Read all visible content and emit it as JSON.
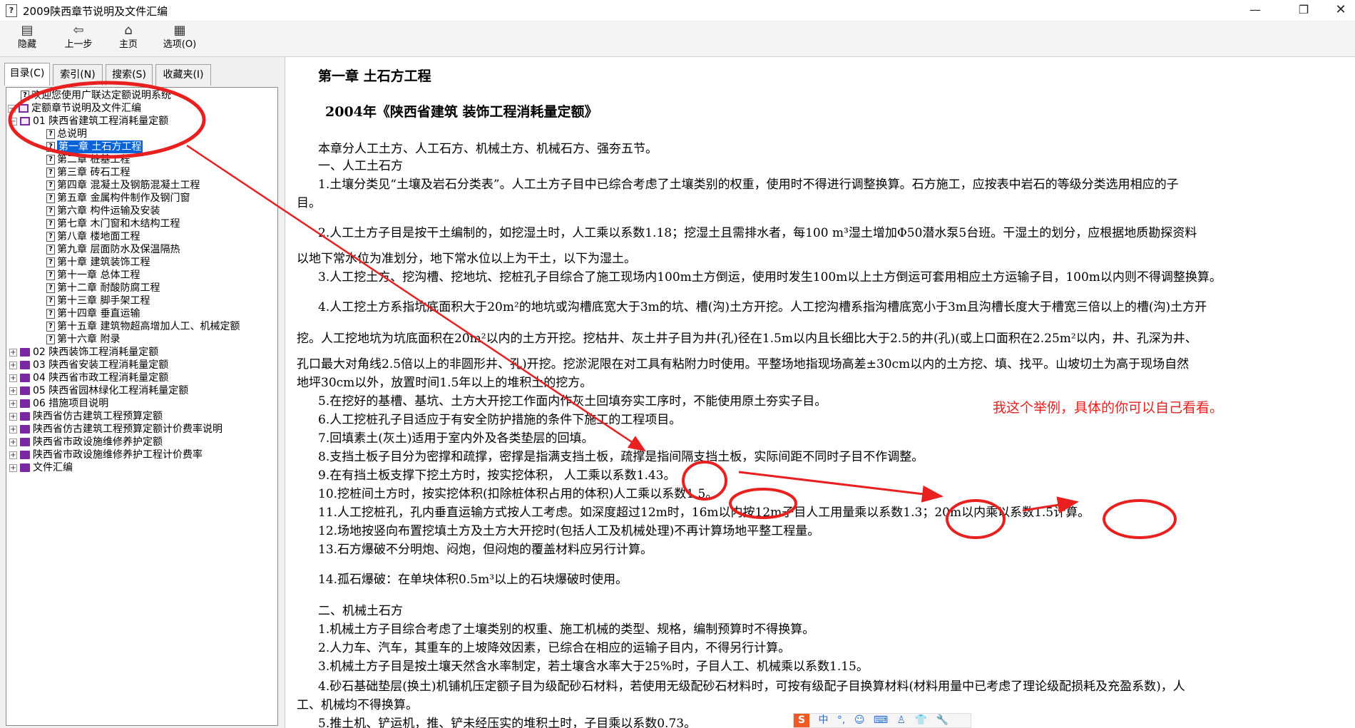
{
  "window": {
    "title": "2009陕西章节说明及文件汇编",
    "icon_glyph": "?",
    "minimize_glyph": "—",
    "maximize_glyph": "❐",
    "close_glyph": "✕"
  },
  "toolbar": {
    "hide": {
      "label": "隐藏",
      "icon": "hide-pane-icon",
      "glyph": "▤"
    },
    "back": {
      "label": "上一步",
      "icon": "back-arrow-icon",
      "glyph": "⇦"
    },
    "home": {
      "label": "主页",
      "icon": "home-icon",
      "glyph": "⌂"
    },
    "options": {
      "label": "选项(O)",
      "icon": "options-icon",
      "glyph": "▦"
    }
  },
  "tabs": [
    "目录(C)",
    "索引(N)",
    "搜索(S)",
    "收藏夹(I)"
  ],
  "tree": [
    {
      "text": "欢迎您使用广联达定额说明系统",
      "level": 1,
      "type": "doc"
    },
    {
      "text": "定额章节说明及文件汇编",
      "level": 0,
      "type": "bookopen",
      "exp": "⊟"
    },
    {
      "text": "01 陕西省建筑工程消耗量定额",
      "level": 1,
      "type": "bookopen",
      "exp": "⊟"
    },
    {
      "text": "总说明",
      "level": 2,
      "type": "doc"
    },
    {
      "text": "第一章 土石方工程",
      "level": 2,
      "type": "doc",
      "selected": true
    },
    {
      "text": "第二章 桩基工程",
      "level": 2,
      "type": "doc"
    },
    {
      "text": "第三章 砖石工程",
      "level": 2,
      "type": "doc"
    },
    {
      "text": "第四章 混凝土及钢筋混凝土工程",
      "level": 2,
      "type": "doc"
    },
    {
      "text": "第五章 金属构件制作及钢门窗",
      "level": 2,
      "type": "doc"
    },
    {
      "text": "第六章 构件运输及安装",
      "level": 2,
      "type": "doc"
    },
    {
      "text": "第七章 木门窗和木结构工程",
      "level": 2,
      "type": "doc"
    },
    {
      "text": "第八章 楼地面工程",
      "level": 2,
      "type": "doc"
    },
    {
      "text": "第九章 层面防水及保温隔热",
      "level": 2,
      "type": "doc"
    },
    {
      "text": "第十章 建筑装饰工程",
      "level": 2,
      "type": "doc"
    },
    {
      "text": "第十一章 总体工程",
      "level": 2,
      "type": "doc"
    },
    {
      "text": "第十二章 耐酸防腐工程",
      "level": 2,
      "type": "doc"
    },
    {
      "text": "第十三章 脚手架工程",
      "level": 2,
      "type": "doc"
    },
    {
      "text": "第十四章 垂直运输",
      "level": 2,
      "type": "doc"
    },
    {
      "text": "第十五章 建筑物超高增加人工、机械定额",
      "level": 2,
      "type": "doc"
    },
    {
      "text": "第十六章 附录",
      "level": 2,
      "type": "doc"
    },
    {
      "text": "02 陕西装饰工程消耗量定额",
      "level": 1,
      "type": "book",
      "exp": "⊞"
    },
    {
      "text": "03 陕西省安装工程消耗量定额",
      "level": 1,
      "type": "book",
      "exp": "⊞"
    },
    {
      "text": "04 陕西省市政工程消耗量定额",
      "level": 1,
      "type": "book",
      "exp": "⊞"
    },
    {
      "text": "05 陕西省园林绿化工程消耗量定额",
      "level": 1,
      "type": "book",
      "exp": "⊞"
    },
    {
      "text": "06 措施项目说明",
      "level": 1,
      "type": "book",
      "exp": "⊞"
    },
    {
      "text": "陕西省仿古建筑工程预算定额",
      "level": 1,
      "type": "book",
      "exp": "⊞"
    },
    {
      "text": "陕西省仿古建筑工程预算定额计价费率说明",
      "level": 1,
      "type": "book",
      "exp": "⊞"
    },
    {
      "text": "陕西省市政设施维修养护定额",
      "level": 1,
      "type": "book",
      "exp": "⊞"
    },
    {
      "text": "陕西省市政设施维修养护工程计价费率",
      "level": 1,
      "type": "book",
      "exp": "⊞"
    },
    {
      "text": "文件汇编",
      "level": 1,
      "type": "book",
      "exp": "⊞"
    }
  ],
  "content": {
    "chapter_title": "第一章 土石方工程",
    "subtitle": "2004年《陕西省建筑 装饰工程消耗量定额》",
    "intro": "本章分人工土方、人工石方、机械土方、机械石方、强夯五节。",
    "section1": "一、人工土石方",
    "p1a": "1.土壤分类见“土壤及岩石分类表”。人工土方子目中已综合考虑了土壤类别的权重，使用时不得进行调整换算。石方施工，应按表中岩石的等级分类选用相应的子",
    "p1b": "目。",
    "p2a": "2.人工土方子目是按干土编制的，如挖湿土时，人工乘以系数1.18；挖湿土且需排水者，每100 m³湿土增加Φ50潜水泵5台班。干湿土的划分，应根据地质勘探资料",
    "p2b": "以地下常水位为准划分，地下常水位以上为干土，以下为湿土。",
    "p3": "3.人工挖土方、挖沟槽、挖地坑、挖桩孔子目综合了施工现场内100m土方倒运，使用时发生100m以上土方倒运可套用相应土方运输子目，100m以内则不得调整换算。",
    "p4a": "4.人工挖土方系指坑底面积大于20m²的地坑或沟槽底宽大于3m的坑、槽(沟)土方开挖。人工挖沟槽系指沟槽底宽小于3m且沟槽长度大于槽宽三倍以上的槽(沟)土方开",
    "p4b": "挖。人工挖地坑为坑底面积在20m²以内的土方开挖。挖枯井、灰土井子目为井(孔)径在1.5m以内且长细比大于2.5的井(孔)(或上口面积在2.25m²以内，井、孔深为井、",
    "p4c": "孔口最大对角线2.5倍以上的非圆形井、孔)开挖。挖淤泥限在对工具有粘附力时使用。平整场地指现场高差±30cm以内的土方挖、填、找平。山坡切土为高于现场自然",
    "p4d": "地坪30cm以外，放置时间1.5年以上的堆积土的挖方。",
    "p5": "5.在挖好的基槽、基坑、土方大开挖工作面内作灰土回填夯实工序时，不能使用原土夯实子目。",
    "note": "我这个举例，具体的你可以自己看看。",
    "p6": "6.人工挖桩孔子目适应于有安全防护措施的条件下施工的工程项目。",
    "p7": "7.回填素土(灰土)适用于室内外及各类垫层的回填。",
    "p8": "8.支挡土板子目分为密撑和疏撑，密撑是指满支挡土板，疏撑是指间隔支挡土板，实际间距不同时子目不作调整。",
    "p9": "9.在有挡土板支撑下挖土方时，按实挖体积，  人工乘以系数1.43。",
    "p10": "10.挖桩间土方时，按实挖体积(扣除桩体积占用的体积)人工乘以系数1.5。",
    "p11": "11.人工挖桩孔，孔内垂直运输方式按人工考虑。如深度超过12m时，16m以内按12m子目人工用量乘以系数1.3；20m以内乘以系数1.5计算。",
    "p12": "12.场地按竖向布置挖填土方及土方大开挖时(包括人工及机械处理)不再计算场地平整工程量。",
    "p13": "13.石方爆破不分明炮、闷炮，但闷炮的覆盖材料应另行计算。",
    "p14": "14.孤石爆破：在单块体积0.5m³以上的石块爆破时使用。",
    "section2": "二、机械土石方",
    "m1": "1.机械土方子目综合考虑了土壤类别的权重、施工机械的类型、规格，编制预算时不得换算。",
    "m2": "2.人力车、汽车，其重车的上坡降效因素，已综合在相应的运输子目内，不得另行计算。",
    "m3": "3.机械土方子目是按土壤天然含水率制定，若土壤含水率大于25%时，子目人工、机械乘以系数1.15。",
    "m4a": "4.砂石基础垫层(换土)机铺机压定额子目为级配砂石材料，若使用无级配砂石材料时，可按有级配子目换算材料(材料用量中已考虑了理论级配损耗及充盈系数)，人",
    "m4b": "工、机械均不得换算。",
    "m5": "5.推土机、铲运机，推、铲未经压实的堆积土时，子目乘以系数0.73。"
  },
  "ime": {
    "logo": "S",
    "lang": "中",
    "items": [
      "°,",
      "☺",
      "⌨",
      "♙",
      "👕",
      "🔧"
    ]
  },
  "annotations": {
    "color": "#e82020"
  }
}
